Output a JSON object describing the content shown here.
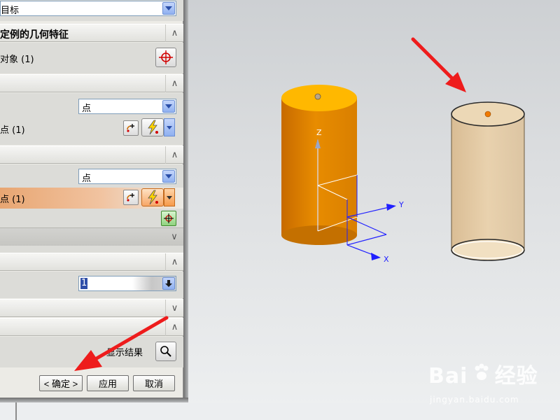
{
  "dialog": {
    "target_combo_value": "目标",
    "section_feature": {
      "title": "定例的几何特征"
    },
    "select_object_label": "对象 (1)",
    "section_reference": {
      "title": ""
    },
    "ref_type_value": "点",
    "ref_point_label": "点 (1)",
    "section_target": {
      "title": ""
    },
    "target_type_value": "点",
    "target_point_label": "点 (1)",
    "section_settings": {
      "title": ""
    },
    "count_value": "1",
    "preview_label": "显示结果",
    "buttons": {
      "ok": "< 确定 >",
      "apply": "应用",
      "cancel": "取消"
    }
  },
  "viewport": {
    "axis_x": "X",
    "axis_y": "Y",
    "axis_z": "Z",
    "colors": {
      "solid_body": "#e58a00",
      "solid_top": "#ffb800",
      "preview_body": "#e8c89a",
      "arrow": "#ee1c1c",
      "axis": "#1a1aff"
    }
  },
  "watermark": {
    "brand": "Bai",
    "brand_suffix": "经验",
    "url": "jingyan.baidu.com"
  }
}
